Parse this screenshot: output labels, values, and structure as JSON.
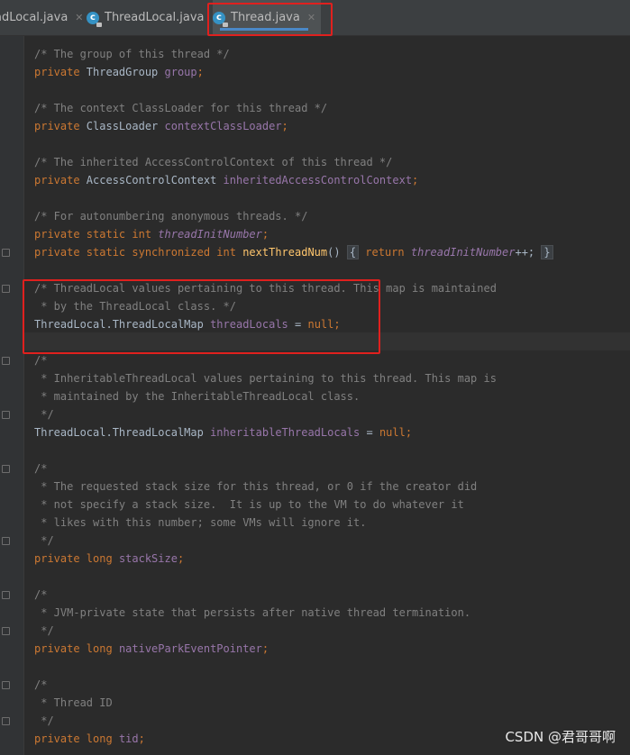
{
  "tabs": [
    {
      "label": "adLocal.java",
      "close": "✕"
    },
    {
      "label": "ThreadLocal.java",
      "close": "✕"
    },
    {
      "label": "Thread.java",
      "close": "✕",
      "active": true
    }
  ],
  "code": {
    "l1": "/* The group of this thread */",
    "l2_kw": "private",
    "l2_type": " ThreadGroup ",
    "l2_field": "group",
    "l2_end": ";",
    "l3": "/* The context ClassLoader for this thread */",
    "l4_kw": "private",
    "l4_type": " ClassLoader ",
    "l4_field": "contextClassLoader",
    "l4_end": ";",
    "l5": "/* The inherited AccessControlContext of this thread */",
    "l6_kw": "private",
    "l6_type": " AccessControlContext ",
    "l6_field": "inheritedAccessControlContext",
    "l6_end": ";",
    "l7": "/* For autonumbering anonymous threads. */",
    "l8_kw": "private static int",
    "l8_field": "threadInitNumber",
    "l8_end": ";",
    "l9_kw": "private static synchronized int",
    "l9_fn": "nextThreadNum",
    "l9_paren": "()",
    "l9_lbrace": "{",
    "l9_ret": "return",
    "l9_field": "threadInitNumber",
    "l9_op": "++;",
    "l9_rbrace": "}",
    "l10": "/* ThreadLocal values pertaining to this thread. This map is maintained",
    "l11": " * by the ThreadLocal class. */",
    "l12_type": "ThreadLocal.ThreadLocalMap ",
    "l12_field": "threadLocals",
    "l12_eq": " = ",
    "l12_null": "null",
    "l12_end": ";",
    "l13": "/*",
    "l14": " * InheritableThreadLocal values pertaining to this thread. This map is",
    "l15": " * maintained by the InheritableThreadLocal class.",
    "l16": " */",
    "l17_type": "ThreadLocal.ThreadLocalMap ",
    "l17_field": "inheritableThreadLocals",
    "l17_eq": " = ",
    "l17_null": "null",
    "l17_end": ";",
    "l18": "/*",
    "l19": " * The requested stack size for this thread, or 0 if the creator did",
    "l20": " * not specify a stack size.  It is up to the VM to do whatever it",
    "l21": " * likes with this number; some VMs will ignore it.",
    "l22": " */",
    "l23_kw": "private long",
    "l23_field": "stackSize",
    "l23_end": ";",
    "l24": "/*",
    "l25": " * JVM-private state that persists after native thread termination.",
    "l26": " */",
    "l27_kw": "private long",
    "l27_field": "nativeParkEventPointer",
    "l27_end": ";",
    "l28": "/*",
    "l29": " * Thread ID",
    "l30": " */",
    "l31_kw": "private long",
    "l31_field": "tid",
    "l31_end": ";"
  },
  "watermark": "CSDN @君哥哥啊",
  "colors": {
    "highlight_box": "#e0201e",
    "keyword": "#cc7832",
    "field": "#9876aa",
    "comment": "#808080",
    "method": "#ffc66d",
    "background": "#2b2b2b"
  }
}
